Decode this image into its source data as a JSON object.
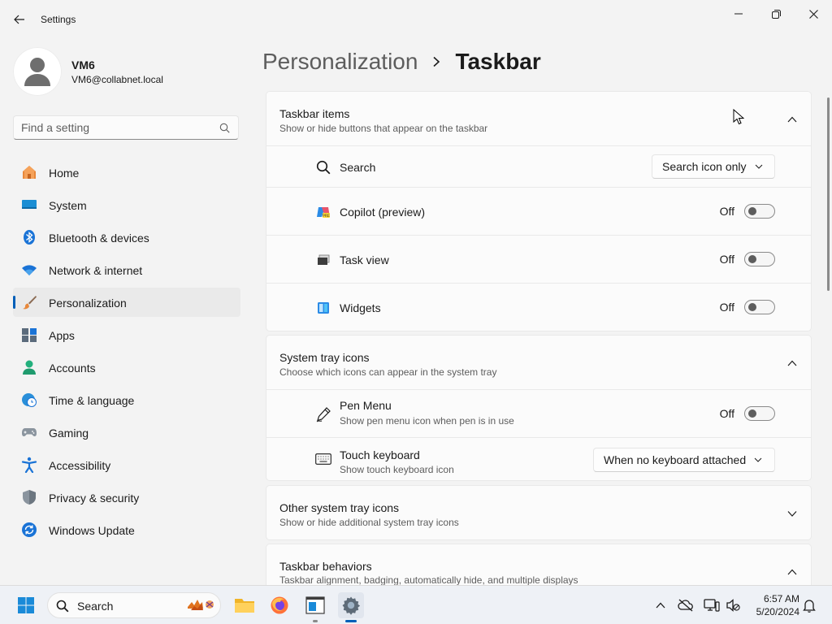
{
  "window": {
    "app_title": "Settings"
  },
  "profile": {
    "name": "VM6",
    "email": "VM6@collabnet.local"
  },
  "search": {
    "placeholder": "Find a setting"
  },
  "sidebar": {
    "items": [
      {
        "label": "Home",
        "icon": "home-icon"
      },
      {
        "label": "System",
        "icon": "system-icon"
      },
      {
        "label": "Bluetooth & devices",
        "icon": "bluetooth-icon"
      },
      {
        "label": "Network & internet",
        "icon": "wifi-icon"
      },
      {
        "label": "Personalization",
        "icon": "brush-icon",
        "active": true
      },
      {
        "label": "Apps",
        "icon": "apps-icon"
      },
      {
        "label": "Accounts",
        "icon": "accounts-icon"
      },
      {
        "label": "Time & language",
        "icon": "clock-globe-icon"
      },
      {
        "label": "Gaming",
        "icon": "gamepad-icon"
      },
      {
        "label": "Accessibility",
        "icon": "accessibility-icon"
      },
      {
        "label": "Privacy & security",
        "icon": "shield-icon"
      },
      {
        "label": "Windows Update",
        "icon": "update-icon"
      }
    ]
  },
  "breadcrumb": {
    "parent": "Personalization",
    "current": "Taskbar"
  },
  "taskbar_items": {
    "title": "Taskbar items",
    "subtitle": "Show or hide buttons that appear on the taskbar",
    "search": {
      "label": "Search",
      "value": "Search icon only"
    },
    "copilot": {
      "label": "Copilot (preview)",
      "state": "Off"
    },
    "task_view": {
      "label": "Task view",
      "state": "Off"
    },
    "widgets": {
      "label": "Widgets",
      "state": "Off"
    }
  },
  "system_tray": {
    "title": "System tray icons",
    "subtitle": "Choose which icons can appear in the system tray",
    "pen_menu": {
      "label": "Pen Menu",
      "subtitle": "Show pen menu icon when pen is in use",
      "state": "Off"
    },
    "touch_keyboard": {
      "label": "Touch keyboard",
      "subtitle": "Show touch keyboard icon",
      "value": "When no keyboard attached"
    }
  },
  "other_tray": {
    "title": "Other system tray icons",
    "subtitle": "Show or hide additional system tray icons"
  },
  "behaviors": {
    "title": "Taskbar behaviors",
    "subtitle": "Taskbar alignment, badging, automatically hide, and multiple displays"
  },
  "taskbar": {
    "search_label": "Search",
    "time": "6:57 AM",
    "date": "5/20/2024"
  },
  "colors": {
    "accent": "#005fb8",
    "background": "#f3f3f3",
    "card": "#fbfbfb"
  }
}
